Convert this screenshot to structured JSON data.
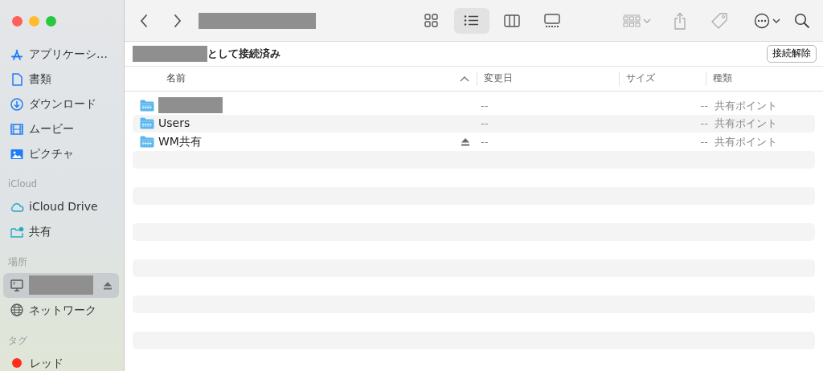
{
  "sidebar": {
    "sections": [
      {
        "items": [
          {
            "label": "アプリケーシ…",
            "selected": false,
            "kind": "normal"
          },
          {
            "label": "書類",
            "selected": false,
            "kind": "normal"
          },
          {
            "label": "ダウンロード",
            "selected": false,
            "kind": "normal"
          },
          {
            "label": "ムービー",
            "selected": false,
            "kind": "normal"
          },
          {
            "label": "ピクチャ",
            "selected": false,
            "kind": "normal"
          }
        ]
      },
      {
        "heading": "iCloud",
        "items": [
          {
            "label": "iCloud Drive",
            "selected": false,
            "kind": "normal"
          },
          {
            "label": "共有",
            "selected": false,
            "kind": "normal"
          }
        ]
      },
      {
        "heading": "場所",
        "items": [
          {
            "selected": true,
            "kind": "redacted",
            "eject": true
          },
          {
            "label": "ネットワーク",
            "selected": false,
            "kind": "normal"
          }
        ]
      },
      {
        "heading": "タグ",
        "items": [
          {
            "label": "レッド",
            "color": "#ff2d20",
            "selected": false,
            "kind": "tag"
          }
        ]
      }
    ]
  },
  "toolbar": {
    "view_modes": [
      {
        "selected": false
      },
      {
        "selected": true
      },
      {
        "selected": false
      },
      {
        "selected": false
      }
    ]
  },
  "connection_bar": {
    "text": "として接続済み",
    "button": "接続解除"
  },
  "table": {
    "columns": [
      {
        "label": "名前",
        "sorted": true
      },
      {
        "label": "変更日",
        "sorted": false
      },
      {
        "label": "サイズ",
        "sorted": false
      },
      {
        "label": "種類",
        "sorted": false
      }
    ],
    "rows": [
      {
        "kind": "redacted",
        "modified": "--",
        "size": "--",
        "type": "共有ポイント",
        "eject": false
      },
      {
        "kind": "folder",
        "name": "Users",
        "modified": "--",
        "size": "--",
        "type": "共有ポイント",
        "eject": false
      },
      {
        "kind": "folder",
        "name": "WM共有",
        "modified": "--",
        "size": "--",
        "type": "共有ポイント",
        "eject": true
      }
    ]
  }
}
